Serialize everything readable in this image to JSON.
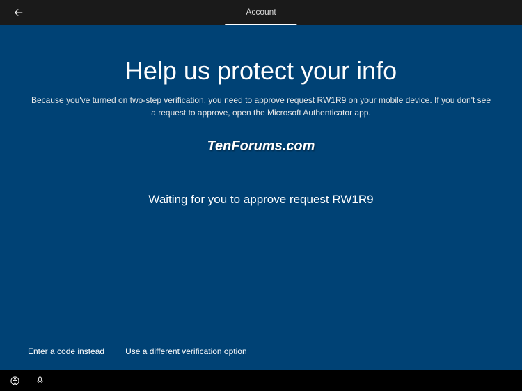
{
  "titlebar": {
    "tab_label": "Account"
  },
  "main": {
    "heading": "Help us protect your info",
    "description": "Because you've turned on two-step verification, you need to approve request RW1R9 on your mobile device. If you don't see a request to approve, open the Microsoft Authenticator app.",
    "watermark": "TenForums.com",
    "status": "Waiting for you to approve request RW1R9"
  },
  "links": {
    "enter_code": "Enter a code instead",
    "different_option": "Use a different verification option"
  }
}
